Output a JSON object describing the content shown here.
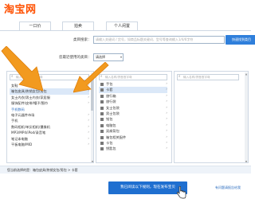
{
  "header": {
    "logo": "淘宝网"
  },
  "tabs": [
    {
      "label": "一口价"
    },
    {
      "label": "拍卖"
    },
    {
      "label": "个人闲置"
    }
  ],
  "form": {
    "category_search_label": "类目搜索：",
    "category_search_placeholder": "请输入关键词 / 货号，如商品标题关键词、型号等查询输入1/4/6字符",
    "search_button": "快速找到类目",
    "recent_label": "您最近使用的类目：",
    "recent_select_value": "请选择"
  },
  "columns": [
    {
      "search_placeholder": "输入名称/拼音首字母",
      "items": [
        {
          "label": "女鞋",
          "has_children": true
        },
        {
          "label": "箱包皮具/热销女包/男包",
          "has_children": true,
          "selected": true
        },
        {
          "label": "女士内衣/男士内衣/家居服",
          "has_children": true
        },
        {
          "label": "服饰配件/皮带/帽子/围巾",
          "has_children": true
        },
        {
          "label": "手机数码",
          "group": true
        },
        {
          "label": "电子元器件市场",
          "has_children": true
        },
        {
          "label": "手机",
          "has_children": true
        },
        {
          "label": "数码相机/单反相机/摄像机",
          "has_children": true
        },
        {
          "label": "MP3/MP4/iPod/录音笔",
          "has_children": true
        },
        {
          "label": "笔记本电脑",
          "has_children": true
        },
        {
          "label": "平板电脑/MID",
          "has_children": true
        }
      ]
    },
    {
      "search_placeholder": "输入名称/拼音首字母",
      "items": [
        {
          "label": "手包",
          "has_children": true
        },
        {
          "label": "卡套",
          "has_children": true,
          "selected": true
        },
        {
          "label": "旅行箱",
          "has_children": true
        },
        {
          "label": "旅行袋",
          "has_children": true
        },
        {
          "label": "女士包袋",
          "has_children": true
        },
        {
          "label": "男士包袋",
          "has_children": true
        },
        {
          "label": "钱包",
          "has_children": true
        },
        {
          "label": "电脑包",
          "has_children": true
        },
        {
          "label": "双肩背包",
          "has_children": true
        },
        {
          "label": "箱包相关配件",
          "has_children": true
        },
        {
          "label": "卡包",
          "has_children": true
        },
        {
          "label": "钥匙包",
          "has_children": true
        }
      ]
    },
    {
      "search_placeholder": "输入名称/拼音首字母",
      "items": []
    }
  ],
  "selected_category_text": "您当前选择的是：箱包皮具/热销女包/男包 > 卡套",
  "submit_button": "我已阅读以下规则，现在发布宝贝",
  "help_link": "有问题请报告给我",
  "colors": {
    "accent": "#1f6fd0",
    "logo": "#ff5000",
    "arrow": "#f29a1f",
    "selected_row": "#dbe8f8"
  }
}
